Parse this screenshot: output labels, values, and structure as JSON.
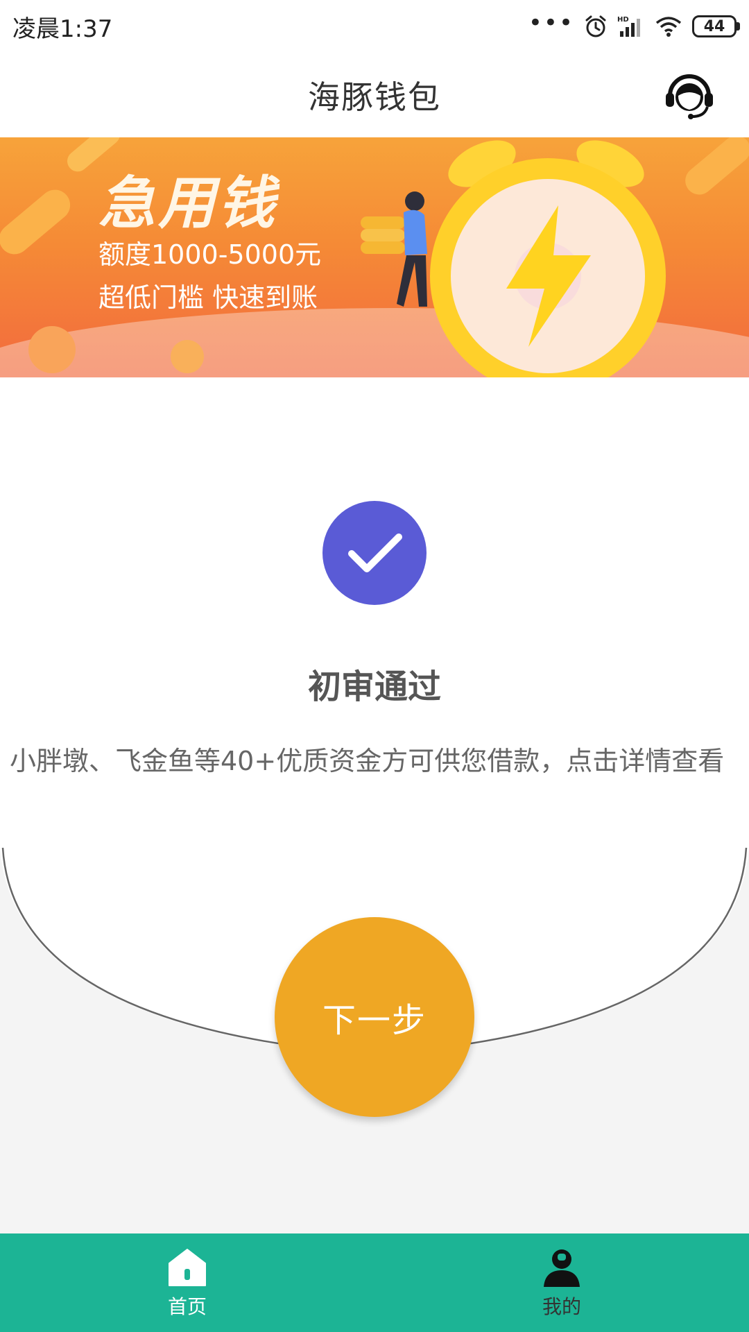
{
  "status_bar": {
    "time": "凌晨1:37",
    "battery": "44",
    "dots": "•••"
  },
  "header": {
    "title": "海豚钱包"
  },
  "banner": {
    "title": "急用钱",
    "line1": "额度1000-5000元",
    "line2": "超低门槛 快速到账"
  },
  "result": {
    "title": "初审通过",
    "description": "小胖墩、飞金鱼等40+优质资金方可供您借款，点击详情查看"
  },
  "action": {
    "next_label": "下一步"
  },
  "bottom_nav": {
    "items": [
      {
        "label": "首页"
      },
      {
        "label": "我的"
      }
    ]
  },
  "colors": {
    "accent_green": "#1cb495",
    "button_orange": "#efa724",
    "check_purple": "#5a5bd6"
  },
  "icons": {
    "support": "headset-icon",
    "check": "check-icon",
    "home": "home-icon",
    "user": "user-icon"
  }
}
